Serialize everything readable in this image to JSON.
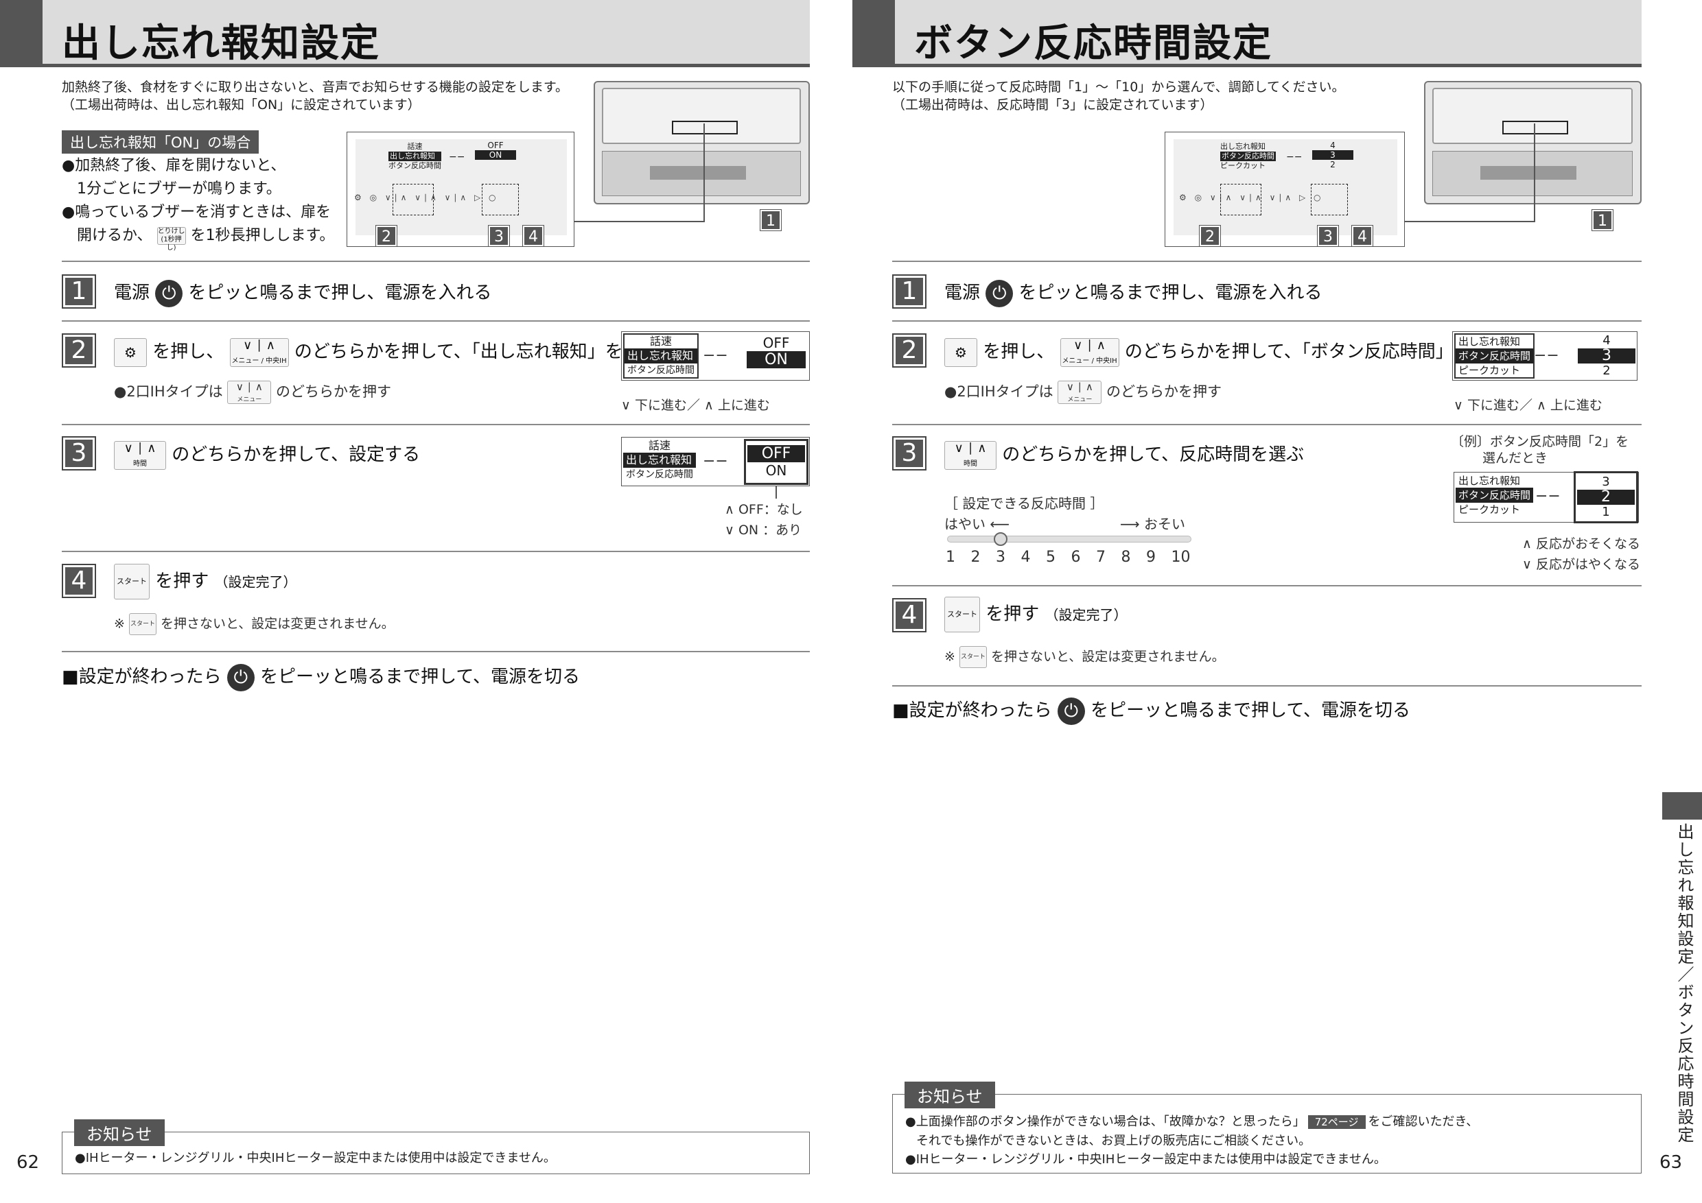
{
  "left": {
    "title": "出し忘れ報知設定",
    "intro": [
      "加熱終了後、食材をすぐに取り出さないと、音声でお知らせする機能の設定をします。",
      "（工場出荷時は、出し忘れ報知「ON」に設定されています）"
    ],
    "case_label": "出し忘れ報知「ON」の場合",
    "case_lines": [
      "●加熱終了後、扉を開けないと、",
      "　1分ごとにブザーが鳴ります。",
      "●鳴っているブザーを消すときは、扉を",
      "　開けるか、",
      "を1秒長押しします。"
    ],
    "diagram": {
      "lcd": [
        "話速",
        "出し忘れ報知",
        "ボタン反応時間"
      ],
      "dash": "−−",
      "vals": [
        "OFF",
        "ON"
      ],
      "callouts": [
        "2",
        "3",
        "4",
        "1"
      ]
    },
    "steps": [
      {
        "num": "1",
        "a": "電源",
        "b": "をピッと鳴るまで押し、電源を入れる"
      },
      {
        "num": "2",
        "a": "を押し、",
        "b": "のどちらかを押して、「出し忘れ報知」を選ぶ",
        "key_sub": "メニュー / 中央IH",
        "sub": "●2口IHタイプは",
        "sub2": "のどちらかを押す",
        "key2_sub": "メニュー",
        "lcd": [
          "話速",
          "出し忘れ報知",
          "ボタン反応時間"
        ],
        "vals": [
          "OFF",
          "ON"
        ],
        "nav": "∨ 下に進む／ ∧ 上に進む"
      },
      {
        "num": "3",
        "b": "のどちらかを押して、設定する",
        "key_sub": "時間",
        "lcd": [
          "話速",
          "出し忘れ報知",
          "ボタン反応時間"
        ],
        "vals": [
          "OFF",
          "ON"
        ],
        "legend": [
          "∧ OFF：なし",
          "∨ ON ：あり"
        ]
      },
      {
        "num": "4",
        "b": "を押す",
        "b2": "（設定完了）",
        "key": "スタート",
        "sub": "※",
        "sub2": "を押さないと、設定は変更されません。"
      }
    ],
    "finish": [
      "■設定が終わったら",
      "をピーッと鳴るまで押して、電源を切る"
    ],
    "note_tag": "お知らせ",
    "note": [
      "●IHヒーター・レンジグリル・中央IHヒーター設定中または使用中は設定できません。"
    ],
    "page": "62"
  },
  "right": {
    "title": "ボタン反応時間設定",
    "intro": [
      "以下の手順に従って反応時間「1」〜「10」から選んで、調節してください。",
      "（工場出荷時は、反応時間「3」に設定されています）"
    ],
    "diagram": {
      "lcd": [
        "出し忘れ報知",
        "ボタン反応時間",
        "ピークカット"
      ],
      "dash": "−−",
      "vals": [
        "4",
        "3",
        "2"
      ],
      "callouts": [
        "2",
        "3",
        "4",
        "1"
      ]
    },
    "steps": [
      {
        "num": "1",
        "a": "電源",
        "b": "をピッと鳴るまで押し、電源を入れる"
      },
      {
        "num": "2",
        "a": "を押し、",
        "b": "のどちらかを押して、「ボタン反応時間」を選ぶ",
        "key_sub": "メニュー / 中央IH",
        "sub": "●2口IHタイプは",
        "sub2": "のどちらかを押す",
        "key2_sub": "メニュー",
        "lcd": [
          "出し忘れ報知",
          "ボタン反応時間",
          "ピークカット"
        ],
        "vals": [
          "4",
          "3",
          "2"
        ],
        "nav": "∨ 下に進む／ ∧ 上に進む"
      },
      {
        "num": "3",
        "b": "のどちらかを押して、反応時間を選ぶ",
        "key_sub": "時間",
        "example": [
          "〔例〕ボタン反応時間「2」を",
          "選んだとき"
        ],
        "lcd": [
          "出し忘れ報知",
          "ボタン反応時間",
          "ピークカット"
        ],
        "vals": [
          "3",
          "2",
          "1"
        ],
        "legend": [
          "∧ 反応がおそくなる",
          "∨ 反応がはやくなる"
        ],
        "scale_title": "［ 設定できる反応時間 ］",
        "scale_fast": "はやい ⟵",
        "scale_slow": "⟶ おそい",
        "scale": [
          "1",
          "2",
          "3",
          "4",
          "5",
          "6",
          "7",
          "8",
          "9",
          "10"
        ]
      },
      {
        "num": "4",
        "b": "を押す",
        "b2": "（設定完了）",
        "key": "スタート",
        "sub": "※",
        "sub2": "を押さないと、設定は変更されません。"
      }
    ],
    "finish": [
      "■設定が終わったら",
      "をピーッと鳴るまで押して、電源を切る"
    ],
    "note_tag": "お知らせ",
    "note": [
      "●上面操作部のボタン操作ができない場合は、「故障かな？と思ったら」",
      "72ページ",
      "をご確認いただき、",
      "それでも操作ができないときは、お買上げの販売店にご相談ください。",
      "●IHヒーター・レンジグリル・中央IHヒーター設定中または使用中は設定できません。"
    ],
    "page": "63",
    "side": "出し忘れ報知設定／ボタン反応時間設定"
  },
  "icons": {
    "power": "power-icon",
    "gear": "gear-icon",
    "up_down": "up-down-arrows-icon",
    "start": "start-icon"
  }
}
